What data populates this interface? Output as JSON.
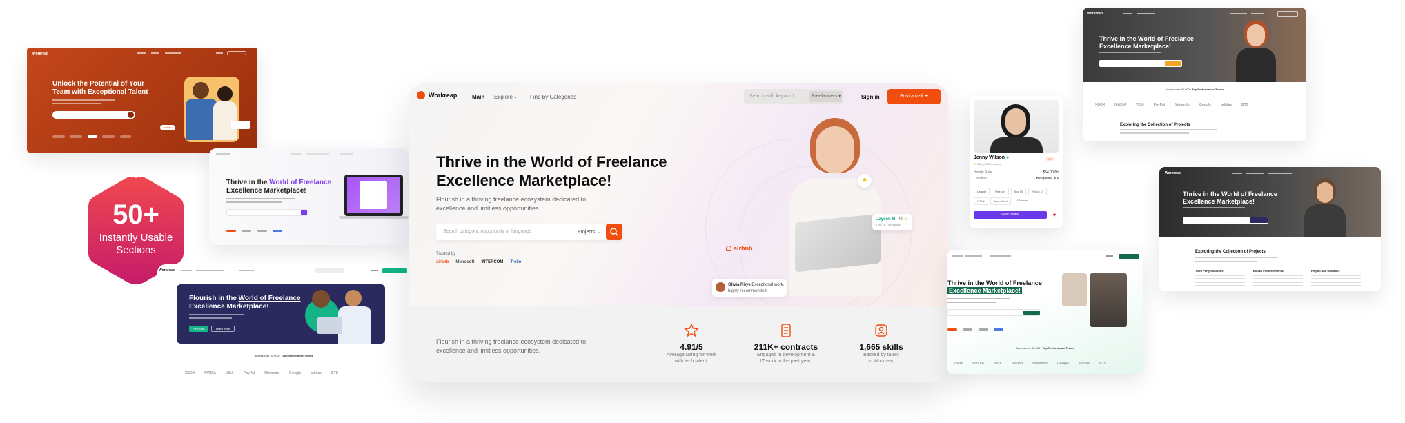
{
  "badge": {
    "count": "50+",
    "line1": "Instantly Usable",
    "line2": "Sections"
  },
  "main": {
    "brand": "Workreap",
    "nav": [
      "Main",
      "Explore",
      "Find by Categories"
    ],
    "search_placeholder": "Search with keyword",
    "search_filter": "Freelancers",
    "sign_in": "Sign in",
    "post_task": "Post a task",
    "title_line1": "Thrive in the World of Freelance",
    "title_line2": "Excellence Marketplace!",
    "subtitle_line1": "Flourish in a thriving freelance ecosystem dedicated to",
    "subtitle_line2": "excellence and limitless opportunities.",
    "hero_search_placeholder": "Search category, opportunity or language",
    "hero_search_filter": "Projects",
    "trusted_by": "Trusted by",
    "trusted_logos": [
      "airbnb",
      "Microsoft",
      "INTERCOM",
      "Trello"
    ],
    "float_airbnb": "airbnb",
    "float_user_name": "Jayson M",
    "float_user_rating": "4.9",
    "float_user_role": "UI/UX Designer",
    "testimonial_name": "Olivia Rhye",
    "testimonial_line1": "Exceptional work,",
    "testimonial_line2": "highly recommended!",
    "footer_text_line1": "Flourish in a thriving freelance ecosystem dedicated to",
    "footer_text_line2": "excellence and limitless opportunities.",
    "stats": [
      {
        "icon": "star-icon",
        "value": "4.91/5",
        "desc1": "Average rating for work",
        "desc2": "with tech talent."
      },
      {
        "icon": "contract-icon",
        "value": "211K+ contracts",
        "desc1": "Engaged in development &",
        "desc2": "IT work in the past year."
      },
      {
        "icon": "skills-icon",
        "value": "1,665 skills",
        "desc1": "Backed by talent",
        "desc2": "on Workreap."
      }
    ]
  },
  "orange_card": {
    "brand": "Workreap",
    "title_line1": "Unlock the Potential of Your",
    "title_line2": "Team with Exceptional Talent"
  },
  "purple_card": {
    "title_pre": "Thrive in the ",
    "title_highlight": "World of Freelance",
    "title_line2": "Excellence Marketplace!"
  },
  "navy_card": {
    "brand": "Workreap",
    "title_pre": "Flourish in the ",
    "title_highlight": "World of Freelance",
    "title_line2": "Excellence Marketplace!",
    "btn_primary": "Post Task",
    "btn_secondary": "Learn more",
    "top_talent_pre": "Access over 30,000+",
    "top_talent_highlight": "Top Performance Teams",
    "logos": [
      "XBOX",
      "NVIDIA",
      "VISA",
      "PayPal",
      "Nintendo",
      "Google",
      "adidas",
      "BTS"
    ]
  },
  "profile_card": {
    "name": "Jenny Wilson",
    "rating": "5.0 (1,235 reviews)",
    "badge": "Pro",
    "rate_label": "Hourly Rate",
    "rate_value": "$54.00 /hr",
    "location_label": "Location",
    "location_value": "Bengaluru, KA",
    "tags": [
      "Laravel",
      "Pixel Art",
      "Spa UI",
      "Redux UI",
      "HTML",
      "Java Script",
      "+12 more"
    ],
    "view_profile": "View Profile"
  },
  "green_card": {
    "title_line1": "Thrive in the World of Freelance",
    "title_line2": "Excellence Marketplace!",
    "top_talent_pre": "Access over 30,000+",
    "top_talent_highlight": "Top Performance Teams",
    "logos": [
      "XBOX",
      "NVIDIA",
      "VISA",
      "PayPal",
      "Nintendo",
      "Google",
      "adidas",
      "BTS"
    ]
  },
  "dark_card_top": {
    "brand": "Workreap",
    "title_line1": "Thrive in the World of Freelance",
    "title_line2": "Excellence Marketplace!",
    "top_talent_pre": "Access over 30,000+",
    "top_talent_highlight": "Top Performance Teams",
    "section_title": "Exploring the Collection of Projects",
    "logos": [
      "XBOX",
      "NVIDIA",
      "VISA",
      "PayPal",
      "Nintendo",
      "Google",
      "adidas",
      "BTS"
    ]
  },
  "dark_card_bottom": {
    "brand": "Workreap",
    "title_line1": "Thrive in the World of Freelance",
    "title_line2": "Excellence Marketplace!",
    "section_title": "Exploring the Collection of Projects",
    "columns": [
      "Third Party Solutions",
      "Blocks From Elementor",
      "Helpful And Guidance"
    ]
  },
  "colors": {
    "accent": "#f04e0f",
    "badge_top": "#f0484f",
    "badge_bottom": "#c61c6a",
    "purple": "#7c3aed",
    "navy": "#2b2a5e",
    "green": "#136b4d",
    "blue_pill": "#6a3ae8"
  }
}
